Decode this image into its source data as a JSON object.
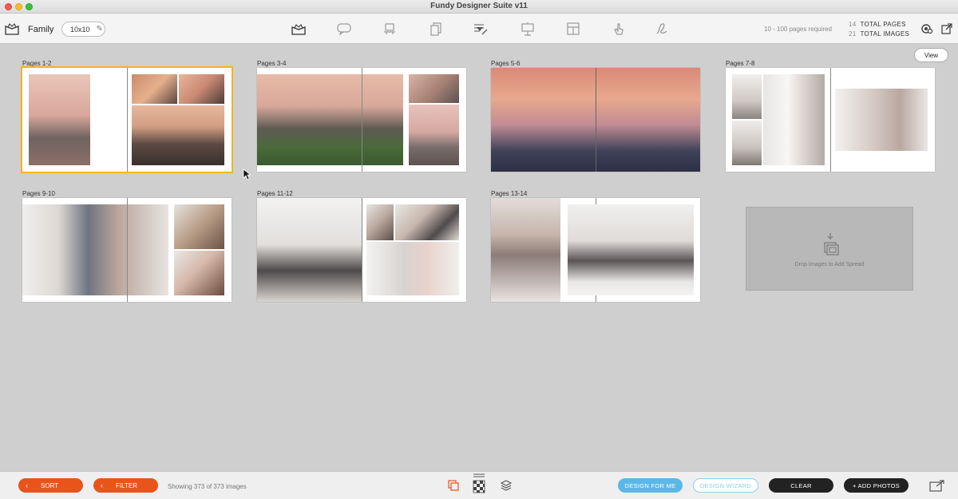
{
  "window": {
    "title": "Fundy Designer Suite v11"
  },
  "toolbar": {
    "album_name": "Family",
    "album_size": "10x10",
    "tools": [
      "album-designer-icon",
      "chat-icon",
      "frame-icon",
      "copy-pages-icon",
      "text-edit-icon",
      "presentation-icon",
      "layout-icon",
      "touch-icon",
      "sign-icon"
    ],
    "pages_required": "10 - 100 pages required",
    "total_pages_num": "14",
    "total_pages_label": "TOTAL PAGES",
    "total_images_num": "21",
    "total_images_label": "TOTAL IMAGES"
  },
  "canvas": {
    "view_label": "View",
    "spreads": [
      {
        "label": "Pages 1-2",
        "selected": true
      },
      {
        "label": "Pages 3-4",
        "selected": false
      },
      {
        "label": "Pages 5-6",
        "selected": false
      },
      {
        "label": "Pages 7-8",
        "selected": false
      },
      {
        "label": "Pages 9-10",
        "selected": false
      },
      {
        "label": "Pages 11-12",
        "selected": false
      },
      {
        "label": "Pages 13-14",
        "selected": false
      }
    ],
    "drop_zone_text": "Drop Images to Add Spread"
  },
  "bottombar": {
    "sort_label": "SORT",
    "filter_label": "FILTER",
    "showing_text": "Showing 373 of 373 images",
    "design_for_me": "DESIGN FOR ME",
    "design_wizard": "DESIGN WIZARD",
    "clear": "CLEAR",
    "add_photos": "+ ADD PHOTOS"
  },
  "colors": {
    "accent_orange": "#e8541a",
    "accent_blue": "#5bb8e6",
    "selection_yellow": "#f2b51a"
  }
}
